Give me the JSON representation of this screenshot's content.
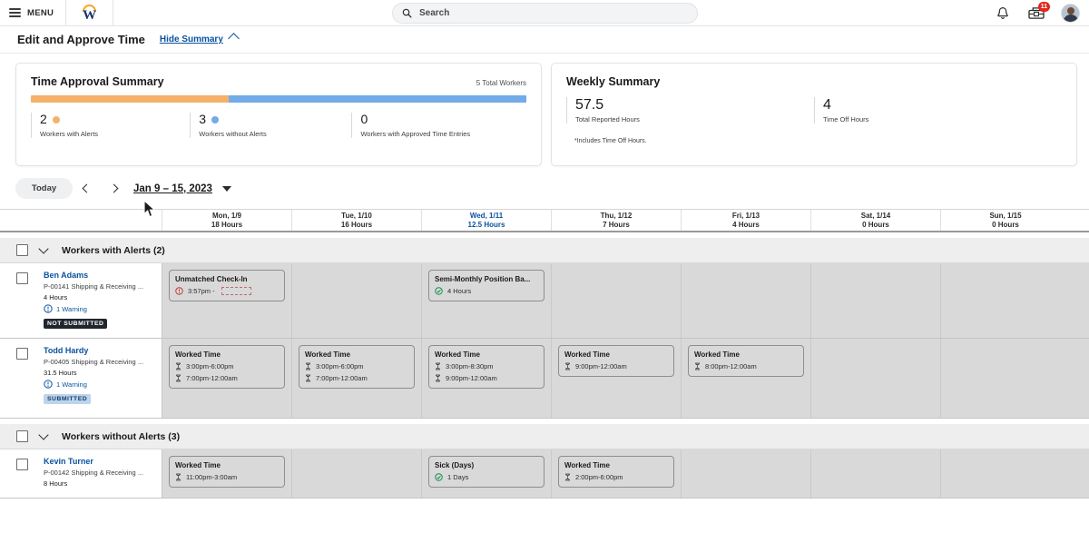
{
  "topbar": {
    "menu_label": "MENU",
    "logo_icon": "workday-w-logo",
    "search": {
      "placeholder": "Search",
      "icon": "search-icon"
    },
    "notifications_icon": "bell-icon",
    "inbox_icon": "inbox-tray-icon",
    "inbox_badge": "11",
    "avatar_icon": "user-avatar"
  },
  "page": {
    "title": "Edit and Approve Time",
    "hide_summary_label": "Hide Summary",
    "collapse_icon": "chevron-up-icon"
  },
  "approval_summary": {
    "title": "Time Approval Summary",
    "total_workers": "5 Total Workers",
    "bar": {
      "orange_pct": 40,
      "blue_pct": 60,
      "orange_color": "#f5b169",
      "blue_color": "#73abe8"
    },
    "stats": [
      {
        "value": "2",
        "label": "Workers with Alerts",
        "dot": "orange"
      },
      {
        "value": "3",
        "label": "Workers without Alerts",
        "dot": "blue"
      },
      {
        "value": "0",
        "label": "Workers with Approved Time Entries",
        "dot": "none"
      }
    ]
  },
  "weekly_summary": {
    "title": "Weekly Summary",
    "stats": [
      {
        "value": "57.5",
        "label": "Total Reported Hours"
      },
      {
        "value": "4",
        "label": "Time Off Hours"
      }
    ],
    "footnote": "*Includes Time Off Hours."
  },
  "datenav": {
    "today_label": "Today",
    "prev_icon": "chevron-left-icon",
    "next_icon": "chevron-right-icon",
    "range_label": "Jan 9 – 15, 2023",
    "dropdown_icon": "caret-down-icon"
  },
  "grid": {
    "columns": [
      {
        "day": "Mon, 1/9",
        "hours": "18 Hours",
        "today": false
      },
      {
        "day": "Tue, 1/10",
        "hours": "16 Hours",
        "today": false
      },
      {
        "day": "Wed, 1/11",
        "hours": "12.5 Hours",
        "today": true
      },
      {
        "day": "Thu, 1/12",
        "hours": "7 Hours",
        "today": false
      },
      {
        "day": "Fri, 1/13",
        "hours": "4 Hours",
        "today": false
      },
      {
        "day": "Sat, 1/14",
        "hours": "0 Hours",
        "today": false
      },
      {
        "day": "Sun, 1/15",
        "hours": "0 Hours",
        "today": false
      }
    ],
    "groups": [
      {
        "label": "Workers with Alerts (2)",
        "rows": [
          {
            "name": "Ben Adams",
            "position": "P-00141 Shipping & Receiving ...",
            "hours": "4 Hours",
            "warning": "1 Warning",
            "warning_icon": "clock-warning-icon",
            "status": "NOT SUBMITTED",
            "status_style": "notsub",
            "entries": [
              {
                "col": 0,
                "title": "Unmatched Check-In",
                "icon": "alert-circle-icon",
                "lines": [
                  {
                    "text": "3:57pm -",
                    "dashed": true
                  }
                ]
              },
              {
                "col": 2,
                "title": "Semi-Monthly Position Ba...",
                "icon": "check-circle-icon",
                "lines": [
                  {
                    "text": "4 Hours",
                    "dashed": false
                  }
                ]
              }
            ]
          },
          {
            "name": "Todd Hardy",
            "position": "P-00405 Shipping & Receiving ...",
            "hours": "31.5 Hours",
            "warning": "1 Warning",
            "warning_icon": "clock-warning-icon",
            "status": "SUBMITTED",
            "status_style": "sub",
            "entries": [
              {
                "col": 0,
                "title": "Worked Time",
                "icon": "hourglass-icon",
                "lines": [
                  {
                    "text": "3:00pm-6:00pm"
                  },
                  {
                    "text": "7:00pm-12:00am"
                  }
                ]
              },
              {
                "col": 1,
                "title": "Worked Time",
                "icon": "hourglass-icon",
                "lines": [
                  {
                    "text": "3:00pm-6:00pm"
                  },
                  {
                    "text": "7:00pm-12:00am"
                  }
                ]
              },
              {
                "col": 2,
                "title": "Worked Time",
                "icon": "hourglass-icon",
                "lines": [
                  {
                    "text": "3:00pm-8:30pm"
                  },
                  {
                    "text": "9:00pm-12:00am"
                  }
                ]
              },
              {
                "col": 3,
                "title": "Worked Time",
                "icon": "hourglass-icon",
                "lines": [
                  {
                    "text": "9:00pm-12:00am"
                  }
                ]
              },
              {
                "col": 4,
                "title": "Worked Time",
                "icon": "hourglass-icon",
                "lines": [
                  {
                    "text": "8:00pm-12:00am"
                  }
                ]
              }
            ]
          }
        ]
      },
      {
        "label": "Workers without Alerts (3)",
        "rows": [
          {
            "name": "Kevin Turner",
            "position": "P-00142 Shipping & Receiving ...",
            "hours": "8 Hours",
            "warning": "",
            "status": "",
            "entries": [
              {
                "col": 0,
                "title": "Worked Time",
                "icon": "hourglass-icon",
                "lines": [
                  {
                    "text": "11:00pm-3:00am"
                  }
                ]
              },
              {
                "col": 2,
                "title": "Sick (Days)",
                "icon": "check-circle-icon",
                "lines": [
                  {
                    "text": "1 Days"
                  }
                ]
              },
              {
                "col": 3,
                "title": "Worked Time",
                "icon": "hourglass-icon",
                "lines": [
                  {
                    "text": "2:00pm-6:00pm"
                  }
                ]
              }
            ]
          }
        ]
      }
    ]
  }
}
